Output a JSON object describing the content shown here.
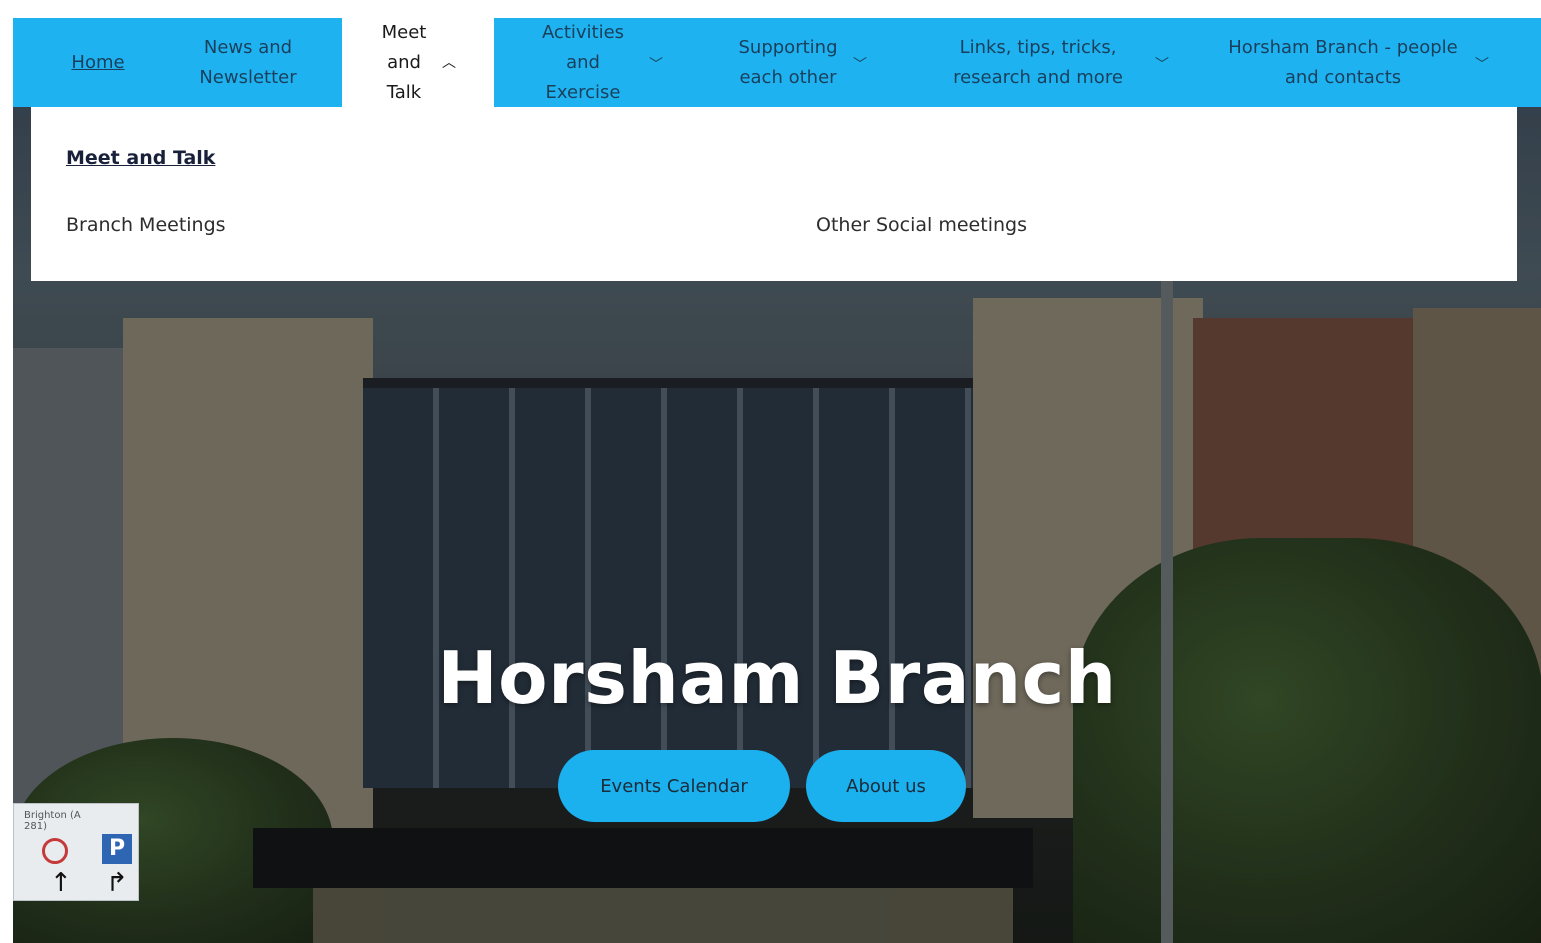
{
  "nav": {
    "home": "Home",
    "news": "News and Newsletter",
    "meet": "Meet and Talk",
    "activities": "Activities and Exercise",
    "supporting": "Supporting each other",
    "links": "Links, tips, tricks, research and more",
    "horsham": "Horsham Branch - people and contacts"
  },
  "dropdown": {
    "title": "Meet and Talk",
    "links": [
      "Branch Meetings",
      "Other Social meetings"
    ]
  },
  "hero": {
    "title": "Horsham Branch",
    "buttons": [
      "Events Calendar",
      "About us"
    ]
  },
  "colors": {
    "nav_bg": "#1eb3f0",
    "button_bg": "#1bb0ee",
    "text_dark": "#1a3f5c"
  },
  "icons": {
    "chevron_up": "chevron-up-icon",
    "chevron_down": "chevron-down-icon"
  }
}
